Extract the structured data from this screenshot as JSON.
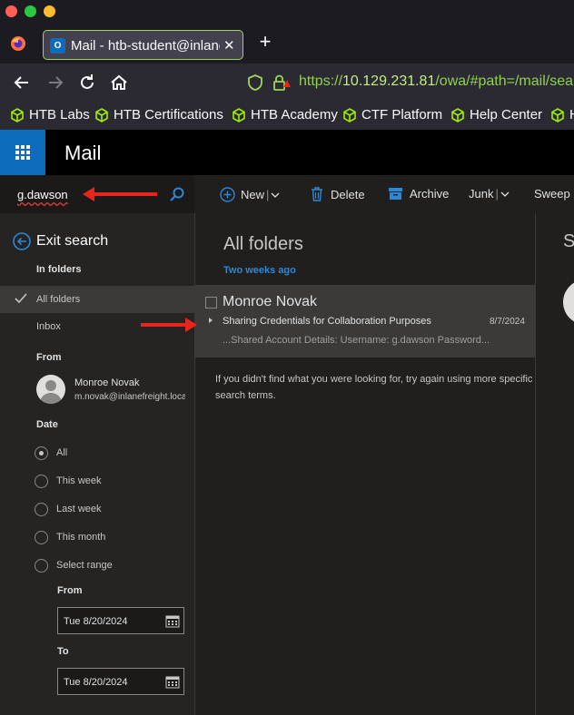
{
  "browser": {
    "tab": {
      "title": "Mail - htb-student@inlanefreight.local",
      "close": "✕",
      "favicon_text": "O"
    },
    "new_tab": "+",
    "url": {
      "scheme": "https://",
      "host": "10.129.231.81",
      "path": "/owa/#path=/mail/search"
    },
    "bookmarks": [
      "HTB Labs",
      "HTB Certifications",
      "HTB Academy",
      "CTF Platform",
      "Help Center",
      "H"
    ],
    "accent": "#9cd65a"
  },
  "app": {
    "title": "Mail",
    "brand_color": "#0f6cbd"
  },
  "search": {
    "query": "g.dawson"
  },
  "sidebar": {
    "exit_search": "Exit search",
    "in_folders_header": "In folders",
    "folders": [
      "All folders",
      "Inbox"
    ],
    "from_header": "From",
    "person": {
      "name": "Monroe Novak",
      "email": "m.novak@inlanefreight.local"
    },
    "date_header": "Date",
    "date_options": [
      "All",
      "This week",
      "Last week",
      "This month",
      "Select range"
    ],
    "selected_date_option": "All",
    "from_label": "From",
    "to_label": "To",
    "from_date": "Tue 8/20/2024",
    "to_date": "Tue 8/20/2024"
  },
  "toolbar": {
    "new": "New",
    "delete": "Delete",
    "archive": "Archive",
    "junk": "Junk",
    "sweep": "Sweep"
  },
  "list": {
    "title": "All folders",
    "group_header": "Two weeks ago",
    "message": {
      "sender": "Monroe Novak",
      "subject": "Sharing Credentials for Collaboration Purposes",
      "date": "8/7/2024",
      "preview": "...Shared Account Details: Username: g.dawson Password..."
    },
    "no_result_text": "If you didn't find what you were looking for, try again using more specific search terms."
  },
  "reading": {
    "letter": "S"
  }
}
